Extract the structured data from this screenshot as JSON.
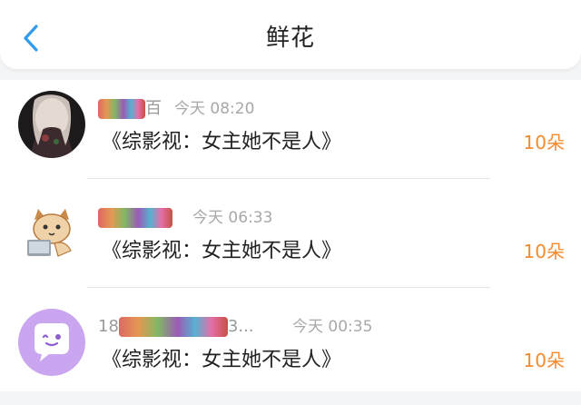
{
  "header": {
    "title": "鲜花"
  },
  "colors": {
    "accent": "#2f9cf0",
    "flower_count": "#f28a2e",
    "muted": "#999999"
  },
  "items": [
    {
      "name_visible": "百",
      "time": "今天 08:20",
      "book": "《综影视：女主她不是人》",
      "flowers": "10朵"
    },
    {
      "name_visible": "",
      "time": "今天 06:33",
      "book": "《综影视：女主她不是人》",
      "flowers": "10朵"
    },
    {
      "name_prefix": "18",
      "name_suffix": "3...",
      "time": "今天 00:35",
      "book": "《综影视：女主她不是人》",
      "flowers": "10朵"
    }
  ]
}
